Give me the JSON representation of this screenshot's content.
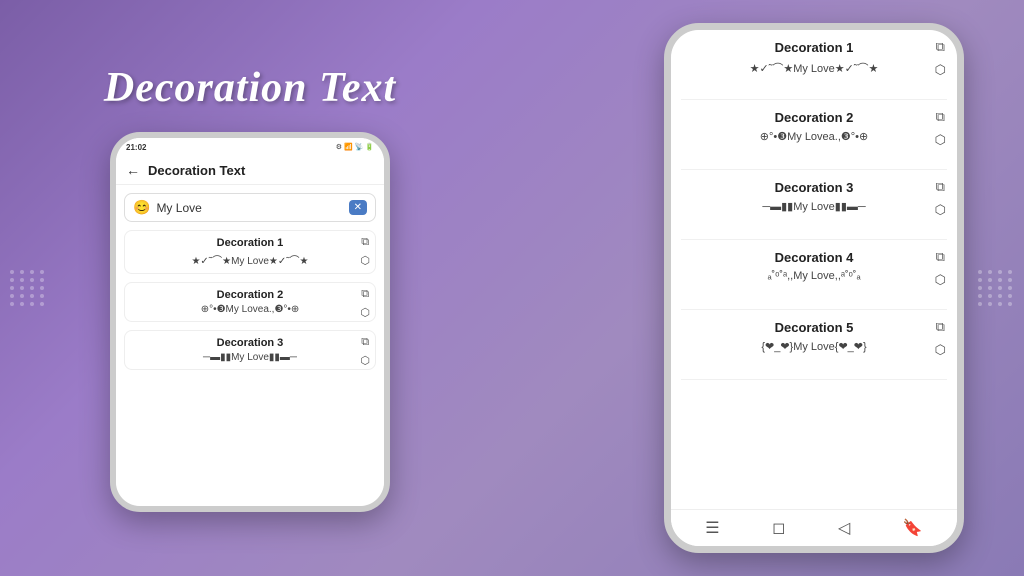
{
  "app": {
    "title": "Decoration Text",
    "background_gradient": "linear-gradient(135deg, #7b5ea7, #9b7cc8, #a08abf)"
  },
  "left_phone": {
    "status_bar": {
      "time": "21:02",
      "icons": "▲ ■ • •",
      "right_icons": "⚙ 📶 📶 🔋"
    },
    "header": {
      "back_icon": "←",
      "title": "Decoration Text"
    },
    "search": {
      "emoji": "😊",
      "placeholder": "My Love",
      "clear_icon": "✕"
    },
    "decorations": [
      {
        "title": "Decoration 1",
        "text": "★✓˜⌒★My Love★✓˜⌒★",
        "copy_icon": "⧉",
        "share_icon": "⬡"
      },
      {
        "title": "Decoration 2",
        "text": "⊕°•❸My Lovea.,❸°•⊕",
        "copy_icon": "⧉",
        "share_icon": "⬡"
      },
      {
        "title": "Decoration 3",
        "text": "─▬▮▮My Love▮▮▬─",
        "copy_icon": "⧉",
        "share_icon": "⬡"
      }
    ]
  },
  "right_phone": {
    "decorations": [
      {
        "title": "Decoration 1",
        "text": "★✓˜⌒★My Love★✓˜⌒★",
        "copy_icon": "⧉",
        "share_icon": "⬡"
      },
      {
        "title": "Decoration 2",
        "text": "⊕°•❸My Lovea.,❸°•⊕",
        "copy_icon": "⧉",
        "share_icon": "⬡"
      },
      {
        "title": "Decoration 3",
        "text": "─▬▮▮My Love▮▮▬─",
        "copy_icon": "⧉",
        "share_icon": "⬡"
      },
      {
        "title": "Decoration 4",
        "text": "ₐ˚ᵒ˚ᵃ,,My Love,,ᵃ˚ᵒ˚ₐ",
        "copy_icon": "⧉",
        "share_icon": "⬡"
      },
      {
        "title": "Decoration 5",
        "text": "{❤_❤}My Love{❤_❤}",
        "copy_icon": "⧉",
        "share_icon": "⬡"
      }
    ],
    "nav": {
      "menu_icon": "☰",
      "home_icon": "◻",
      "back_icon": "◁",
      "bookmark_icon": "🔖"
    }
  }
}
